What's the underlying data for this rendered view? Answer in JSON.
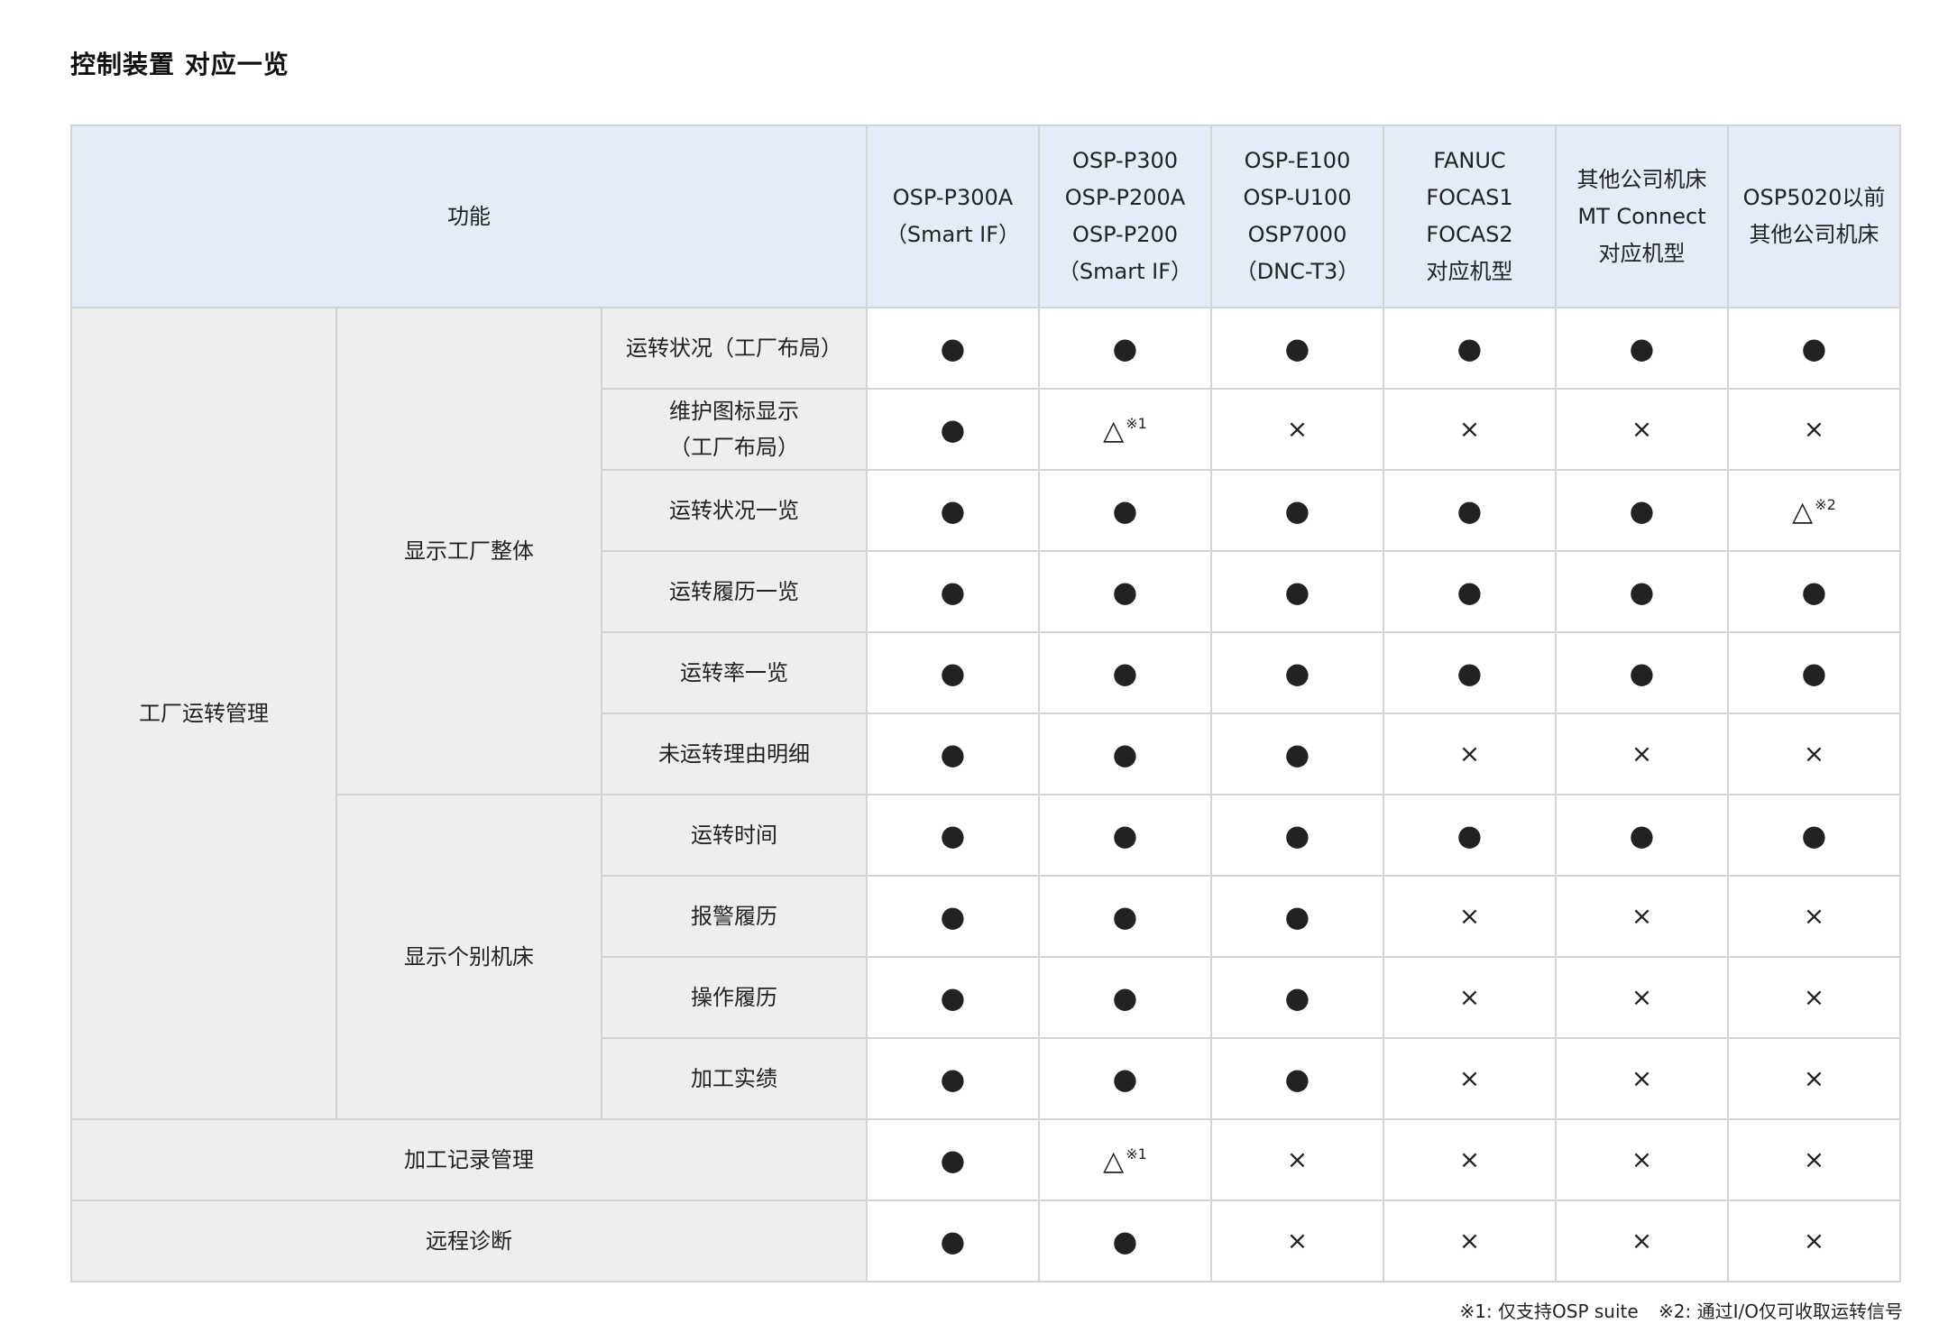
{
  "title": "控制装置 对应一览",
  "header": {
    "feature_label": "功能",
    "columns": [
      [
        "OSP-P300A",
        "（Smart IF）"
      ],
      [
        "OSP-P300",
        "OSP-P200A",
        "OSP-P200",
        "（Smart IF）"
      ],
      [
        "OSP-E100",
        "OSP-U100",
        "OSP7000",
        "（DNC-T3）"
      ],
      [
        "FANUC",
        "FOCAS1",
        "FOCAS2",
        "对应机型"
      ],
      [
        "其他公司机床",
        "MT Connect",
        "对应机型"
      ],
      [
        "OSP5020以前",
        "其他公司机床"
      ]
    ]
  },
  "groups": {
    "factory_mgmt": "工厂运转管理",
    "whole_factory": "显示工厂整体",
    "individual": "显示个别机床"
  },
  "rows": [
    {
      "feature": [
        "运转状况（工厂布局）"
      ],
      "marks": [
        "●",
        "●",
        "●",
        "●",
        "●",
        "●"
      ]
    },
    {
      "feature": [
        "维护图标显示",
        "（工厂布局）"
      ],
      "marks": [
        "●",
        "△",
        "×",
        "×",
        "×",
        "×"
      ],
      "notes": [
        "",
        "※1",
        "",
        "",
        "",
        ""
      ]
    },
    {
      "feature": [
        "运转状况一览"
      ],
      "marks": [
        "●",
        "●",
        "●",
        "●",
        "●",
        "△"
      ],
      "notes": [
        "",
        "",
        "",
        "",
        "",
        "※2"
      ]
    },
    {
      "feature": [
        "运转履历一览"
      ],
      "marks": [
        "●",
        "●",
        "●",
        "●",
        "●",
        "●"
      ]
    },
    {
      "feature": [
        "运转率一览"
      ],
      "marks": [
        "●",
        "●",
        "●",
        "●",
        "●",
        "●"
      ]
    },
    {
      "feature": [
        "未运转理由明细"
      ],
      "marks": [
        "●",
        "●",
        "●",
        "×",
        "×",
        "×"
      ]
    },
    {
      "feature": [
        "运转时间"
      ],
      "marks": [
        "●",
        "●",
        "●",
        "●",
        "●",
        "●"
      ]
    },
    {
      "feature": [
        "报警履历"
      ],
      "marks": [
        "●",
        "●",
        "●",
        "×",
        "×",
        "×"
      ]
    },
    {
      "feature": [
        "操作履历"
      ],
      "marks": [
        "●",
        "●",
        "●",
        "×",
        "×",
        "×"
      ]
    },
    {
      "feature": [
        "加工实绩"
      ],
      "marks": [
        "●",
        "●",
        "●",
        "×",
        "×",
        "×"
      ]
    },
    {
      "feature": [
        "加工记录管理"
      ],
      "marks": [
        "●",
        "△",
        "×",
        "×",
        "×",
        "×"
      ],
      "notes": [
        "",
        "※1",
        "",
        "",
        "",
        ""
      ]
    },
    {
      "feature": [
        "远程诊断"
      ],
      "marks": [
        "●",
        "●",
        "×",
        "×",
        "×",
        "×"
      ]
    }
  ],
  "footnotes": [
    "※1: 仅支持OSP suite",
    "※2: 通过I/O仅可收取运转信号"
  ]
}
